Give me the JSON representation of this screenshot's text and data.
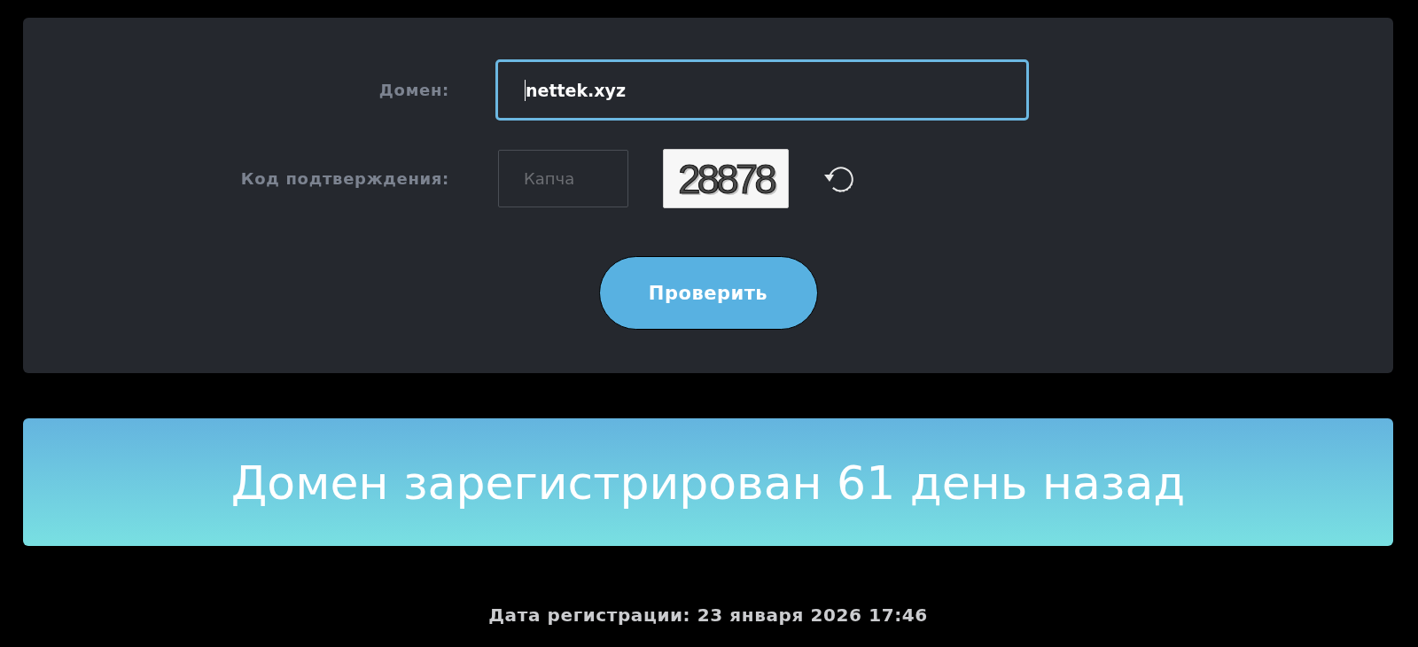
{
  "form": {
    "fields": [
      {
        "kind": "text",
        "label": "Домен:",
        "value": "nettek.xyz",
        "focused": true
      },
      {
        "kind": "captcha",
        "label": "Код подтверждения:",
        "placeholder": "Капча",
        "focused": false,
        "captcha_image_text": "28878"
      }
    ],
    "submit_button": "Проверить"
  },
  "result": {
    "message": "Домен зарегистрирован 61 день назад"
  },
  "registration_date": "Дата регистрации: 23 января 2026 17:46"
}
